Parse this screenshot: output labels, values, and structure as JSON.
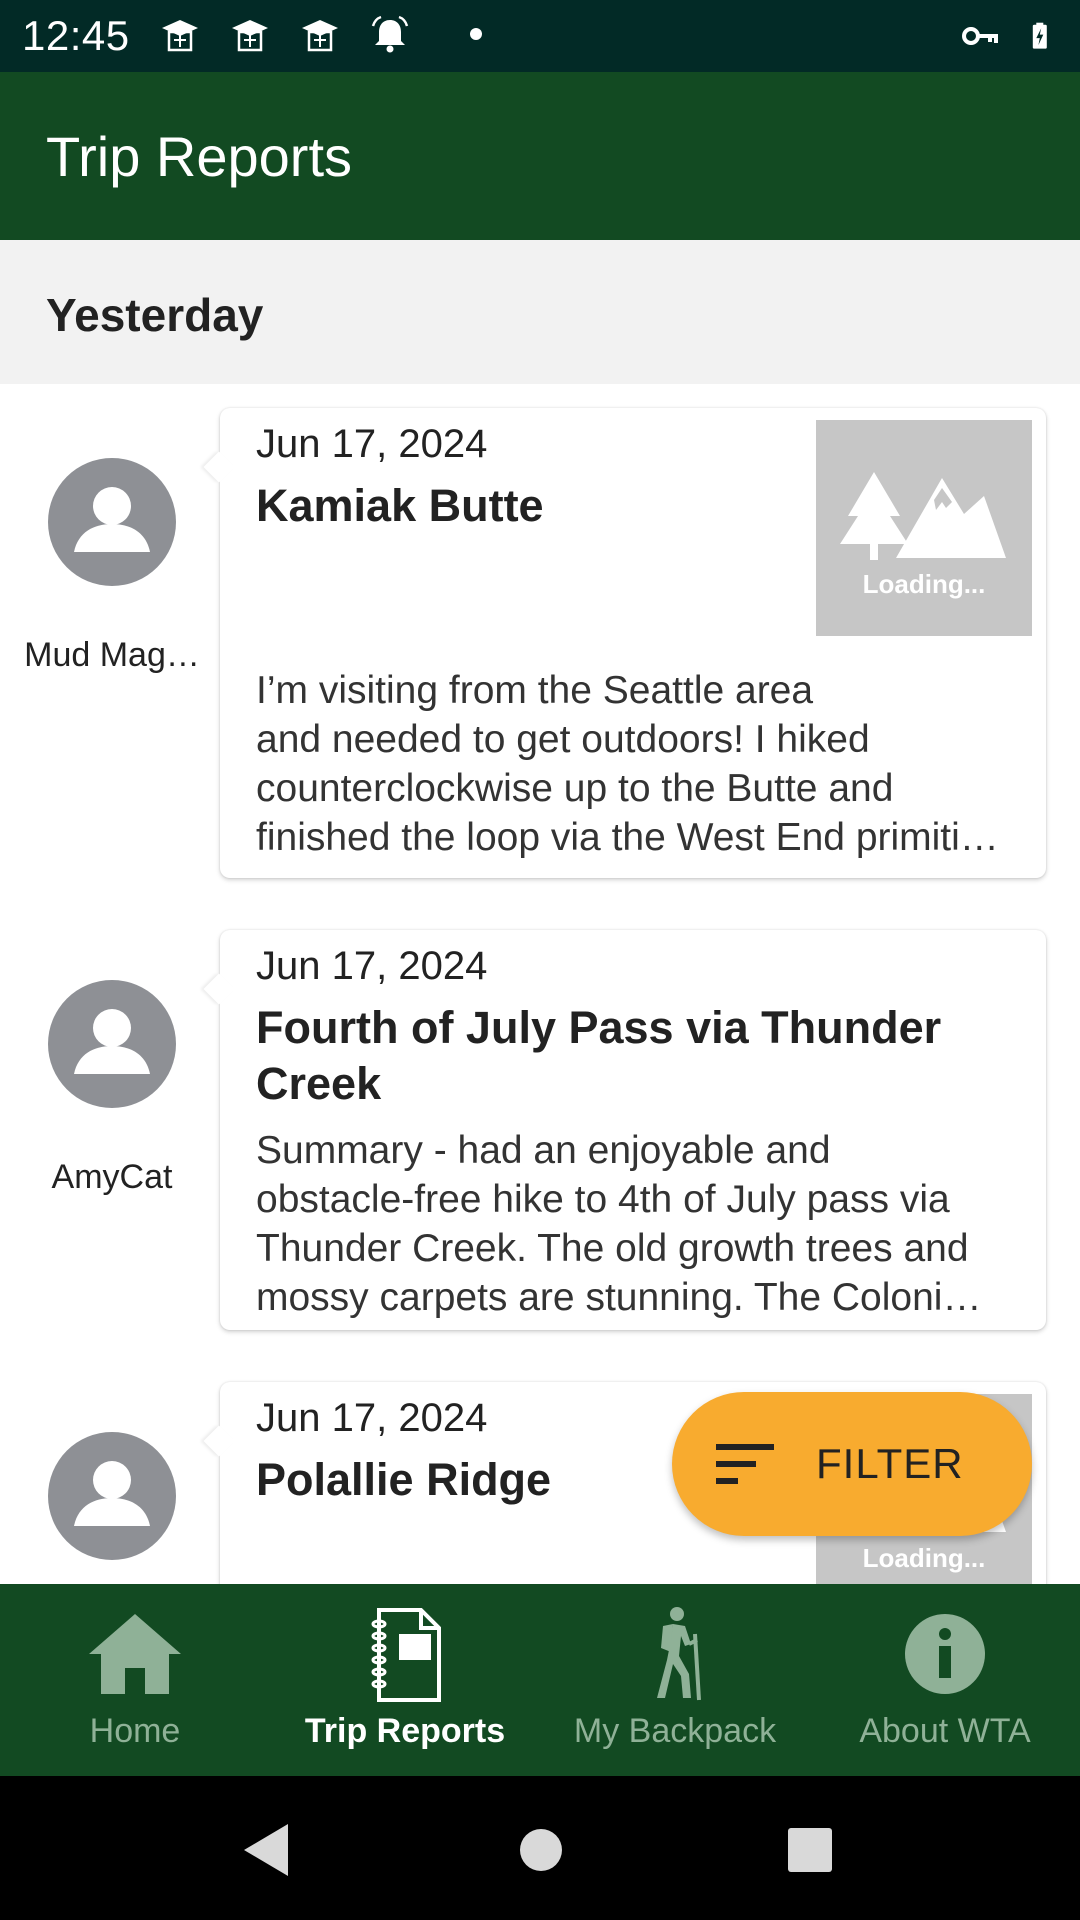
{
  "status_bar": {
    "time": "12:45",
    "left_icons": [
      "graduation-cap-icon",
      "graduation-cap-icon",
      "graduation-cap-icon",
      "alarm-bell-icon",
      "dot-icon"
    ],
    "right_icons": [
      "vpn-key-icon",
      "battery-charging-icon"
    ]
  },
  "app_bar": {
    "title": "Trip Reports"
  },
  "section": {
    "title": "Yesterday"
  },
  "reports": [
    {
      "author": "Mud Mag…",
      "date": "Jun 17, 2024",
      "title": "Kamiak Butte",
      "has_image": true,
      "image_label": "Loading...",
      "body_lines": [
        "I’m visiting from the Seattle area",
        "and needed to get outdoors! I hiked",
        "counterclockwise up to the Butte and",
        "finished the loop via the West End primiti…"
      ]
    },
    {
      "author": "AmyCat",
      "date": "Jun 17, 2024",
      "title_lines": [
        "Fourth of July Pass via Thunder",
        "Creek"
      ],
      "has_image": false,
      "body_lines": [
        "Summary - had an enjoyable and",
        "obstacle-free hike to 4th of July pass via",
        "Thunder Creek. The old growth trees and",
        "mossy carpets are stunning.  The Coloni…"
      ]
    },
    {
      "author": "",
      "date": "Jun 17, 2024",
      "title": "Polallie Ridge",
      "has_image": true,
      "image_label": "Loading..."
    }
  ],
  "fab": {
    "label": "FILTER",
    "icon": "filter-sort-icon"
  },
  "bottom_nav": {
    "active": "Trip Reports",
    "items": [
      {
        "label": "Home",
        "icon": "home-icon"
      },
      {
        "label": "Trip Reports",
        "icon": "notebook-icon"
      },
      {
        "label": "My Backpack",
        "icon": "hiker-icon"
      },
      {
        "label": "About WTA",
        "icon": "info-icon"
      }
    ]
  },
  "colors": {
    "status_bar": "#022a26",
    "app_bar": "#124a22",
    "fab": "#f8ab2f",
    "nav_inactive": "#8fb197",
    "avatar": "#8e9095"
  }
}
